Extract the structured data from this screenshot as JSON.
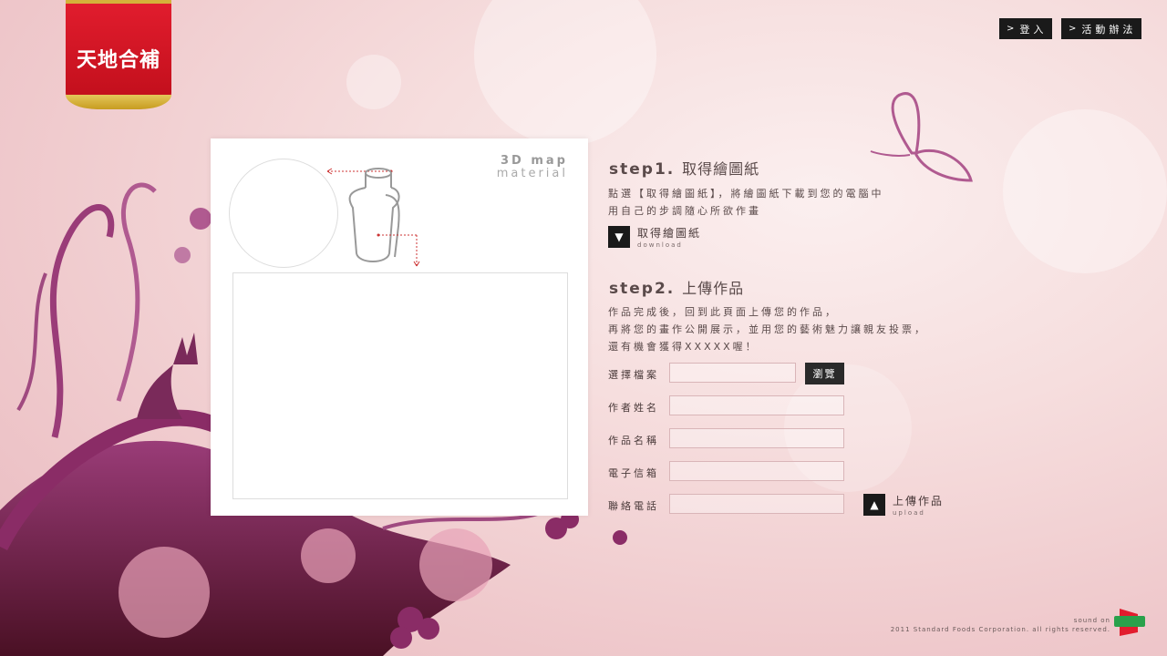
{
  "logo": {
    "text": "天地合補"
  },
  "nav": {
    "login": "登入",
    "rules": "活動辦法"
  },
  "panel": {
    "title_line1": "3D map",
    "title_line2": "material"
  },
  "step1": {
    "title": "step1.",
    "title_zh": "取得繪圖紙",
    "desc_line1": "點選【取得繪圖紙】，將繪圖紙下載到您的電腦中",
    "desc_line2": "用自己的步調隨心所欲作畫",
    "download_label": "取得繪圖紙",
    "download_sub": "download"
  },
  "step2": {
    "title": "step2.",
    "title_zh": "上傳作品",
    "desc_line1": "作品完成後，回到此頁面上傳您的作品，",
    "desc_line2": "再將您的畫作公開展示，並用您的藝術魅力讓親友投票，",
    "desc_line3": "還有機會獲得XXXXX喔！"
  },
  "form": {
    "file_label": "選擇檔案",
    "browse": "瀏覽",
    "author_label": "作者姓名",
    "work_label": "作品名稱",
    "email_label": "電子信箱",
    "phone_label": "聯絡電話",
    "file_value": "",
    "author_value": "",
    "work_value": "",
    "email_value": "",
    "phone_value": "",
    "upload_label": "上傳作品",
    "upload_sub": "upload"
  },
  "footer": {
    "sound": "sound on",
    "copyright": "2011 Standard Foods Corporation. all rights reserved."
  },
  "colors": {
    "accent_red": "#e21d2e",
    "dark": "#1a1a1a",
    "purple": "#7a2a5a"
  }
}
